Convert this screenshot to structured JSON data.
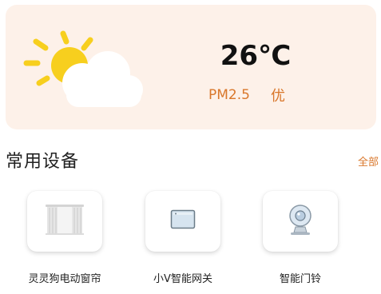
{
  "weather": {
    "icon": "sun-behind-cloud-icon",
    "temperature": "26℃",
    "aqi_label": "PM2.5",
    "aqi_level": "优"
  },
  "devices_section": {
    "title": "常用设备",
    "see_all_label": "全部",
    "items": [
      {
        "label": "灵灵狗电动窗帘",
        "icon": "curtain-icon"
      },
      {
        "label": "小V智能网关",
        "icon": "gateway-icon"
      },
      {
        "label": "智能门铃",
        "icon": "doorbell-camera-icon"
      }
    ]
  },
  "colors": {
    "accent": "#d9772b",
    "card_background": "#fdf1e9",
    "sun": "#f7cf1e",
    "cloud": "#ffffff"
  }
}
